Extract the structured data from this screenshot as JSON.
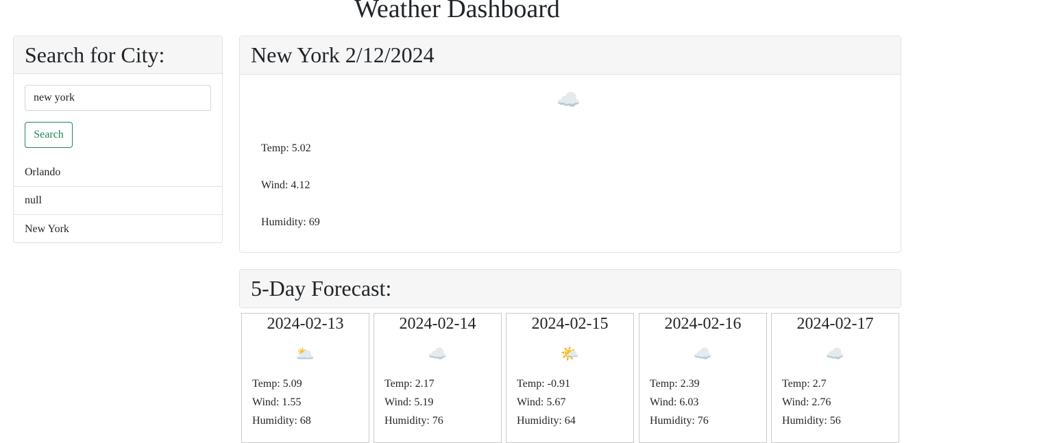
{
  "header": {
    "title": "Weather Dashboard"
  },
  "search": {
    "heading": "Search for City:",
    "input_value": "new york",
    "button_label": "Search",
    "history": [
      "Orlando",
      "null",
      "New York"
    ]
  },
  "current": {
    "title": "New York 2/12/2024",
    "icon": "cloud-icon",
    "icon_glyph": "☁️",
    "temp": "Temp: 5.02",
    "wind": "Wind: 4.12",
    "humidity": "Humidity: 69"
  },
  "forecast": {
    "heading": "5-Day Forecast:",
    "days": [
      {
        "date": "2024-02-13",
        "icon": "partly-cloudy-icon",
        "icon_glyph": "🌥️",
        "temp": "Temp: 5.09",
        "wind": "Wind: 1.55",
        "humidity": "Humidity: 68"
      },
      {
        "date": "2024-02-14",
        "icon": "cloud-icon",
        "icon_glyph": "☁️",
        "temp": "Temp: 2.17",
        "wind": "Wind: 5.19",
        "humidity": "Humidity: 76"
      },
      {
        "date": "2024-02-15",
        "icon": "few-clouds-icon",
        "icon_glyph": "🌤️",
        "temp": "Temp: -0.91",
        "wind": "Wind: 5.67",
        "humidity": "Humidity: 64"
      },
      {
        "date": "2024-02-16",
        "icon": "cloud-icon",
        "icon_glyph": "☁️",
        "temp": "Temp: 2.39",
        "wind": "Wind: 6.03",
        "humidity": "Humidity: 76"
      },
      {
        "date": "2024-02-17",
        "icon": "cloud-icon",
        "icon_glyph": "☁️",
        "temp": "Temp: 2.7",
        "wind": "Wind: 2.76",
        "humidity": "Humidity: 56"
      }
    ]
  },
  "colors": {
    "search_button": "#198754",
    "card_header_bg": "#f6f6f6",
    "border": "#dee2e6"
  }
}
